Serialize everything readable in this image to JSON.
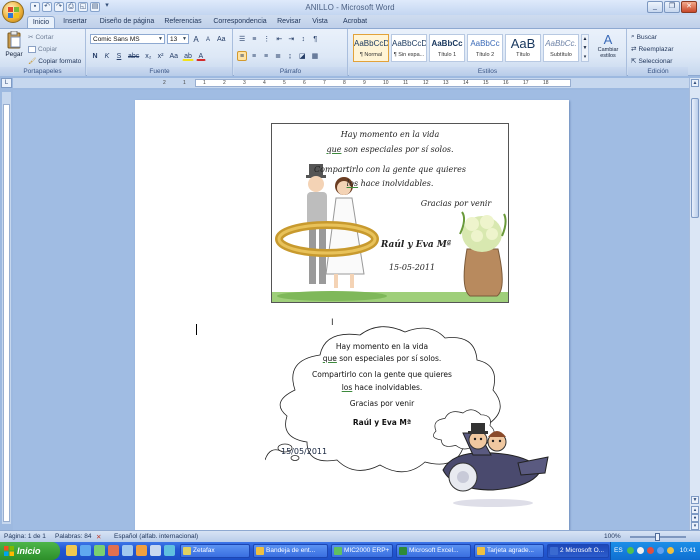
{
  "window": {
    "title": "ANILLO - Microsoft Word",
    "qat_icons": [
      "save-icon",
      "undo-icon",
      "redo-icon",
      "print-icon",
      "preview-icon",
      "open-icon"
    ],
    "controls": [
      "_",
      "❐",
      "✕"
    ]
  },
  "tabs": [
    "Inicio",
    "Insertar",
    "Diseño de página",
    "Referencias",
    "Correspondencia",
    "Revisar",
    "Vista",
    "Acrobat"
  ],
  "ribbon": {
    "clipboard": {
      "paste": "Pegar",
      "cut": "Cortar",
      "copy": "Copiar",
      "format_painter": "Copiar formato",
      "label": "Portapapeles"
    },
    "font": {
      "family": "Comic Sans MS",
      "size": "13",
      "label": "Fuente",
      "grow": "A",
      "shrink": "A",
      "clear": "Aa",
      "bold": "N",
      "italic": "K",
      "underline": "S",
      "strike": "abc",
      "sub": "x₂",
      "sup": "x²",
      "case": "Aa",
      "highlight": "ab",
      "color": "A"
    },
    "paragraph": {
      "label": "Párrafo",
      "pilcrow": "¶"
    },
    "styles": {
      "label": "Estilos",
      "items": [
        {
          "preview": "AaBbCcDc",
          "name": "¶ Normal"
        },
        {
          "preview": "AaBbCcDc",
          "name": "¶ Sin espa..."
        },
        {
          "preview": "AaBbCc",
          "name": "Título 1"
        },
        {
          "preview": "AaBbCc",
          "name": "Título 2"
        },
        {
          "preview": "AaB",
          "name": "Título"
        },
        {
          "preview": "AaBbCc.",
          "name": "Subtítulo"
        }
      ],
      "change": "Cambiar estilos"
    },
    "editing": {
      "label": "Edición",
      "find": "Buscar",
      "replace": "Reemplazar",
      "select": "Seleccionar"
    }
  },
  "ruler": {
    "corner": "L",
    "ticks": [
      "2",
      "1",
      "1",
      "2",
      "3",
      "4",
      "5",
      "6",
      "7",
      "8",
      "9",
      "10",
      "11",
      "12",
      "13",
      "14",
      "15",
      "16",
      "17",
      "18"
    ]
  },
  "card": {
    "line1": "Hay momento en la vida",
    "line2a": "que",
    "line2b": " son especiales por sí solos.",
    "line3": "Compartirlo con la gente que quieres",
    "line4a": "los",
    "line4b": " hace inolvidables.",
    "thanks": "Gracias por venir",
    "names": "Raúl y Eva Mª",
    "date": "15-05-2011"
  },
  "cloud": {
    "line1": "Hay momento en la vida",
    "line2a": "que",
    "line2b": " son especiales por sí solos.",
    "line3": "Compartirlo con la gente que quieres",
    "line4a": "los",
    "line4b": " hace inolvidables.",
    "thanks": "Gracias por venir",
    "names": "Raúl y Eva Mª",
    "date": "15/05/2011"
  },
  "status": {
    "page": "Página: 1 de 1",
    "words": "Palabras: 84",
    "lang": "Español (alfab. internacional)",
    "zoom": "100%"
  },
  "taskbar": {
    "start": "Inicio",
    "tasks": [
      "Zetafax",
      "Bandeja de ent...",
      "MIC2000 ERP+",
      "Microsoft Excel...",
      "Tarjeta agrade...",
      "2 Microsoft O..."
    ],
    "lang": "ES",
    "clock": "10:41"
  }
}
